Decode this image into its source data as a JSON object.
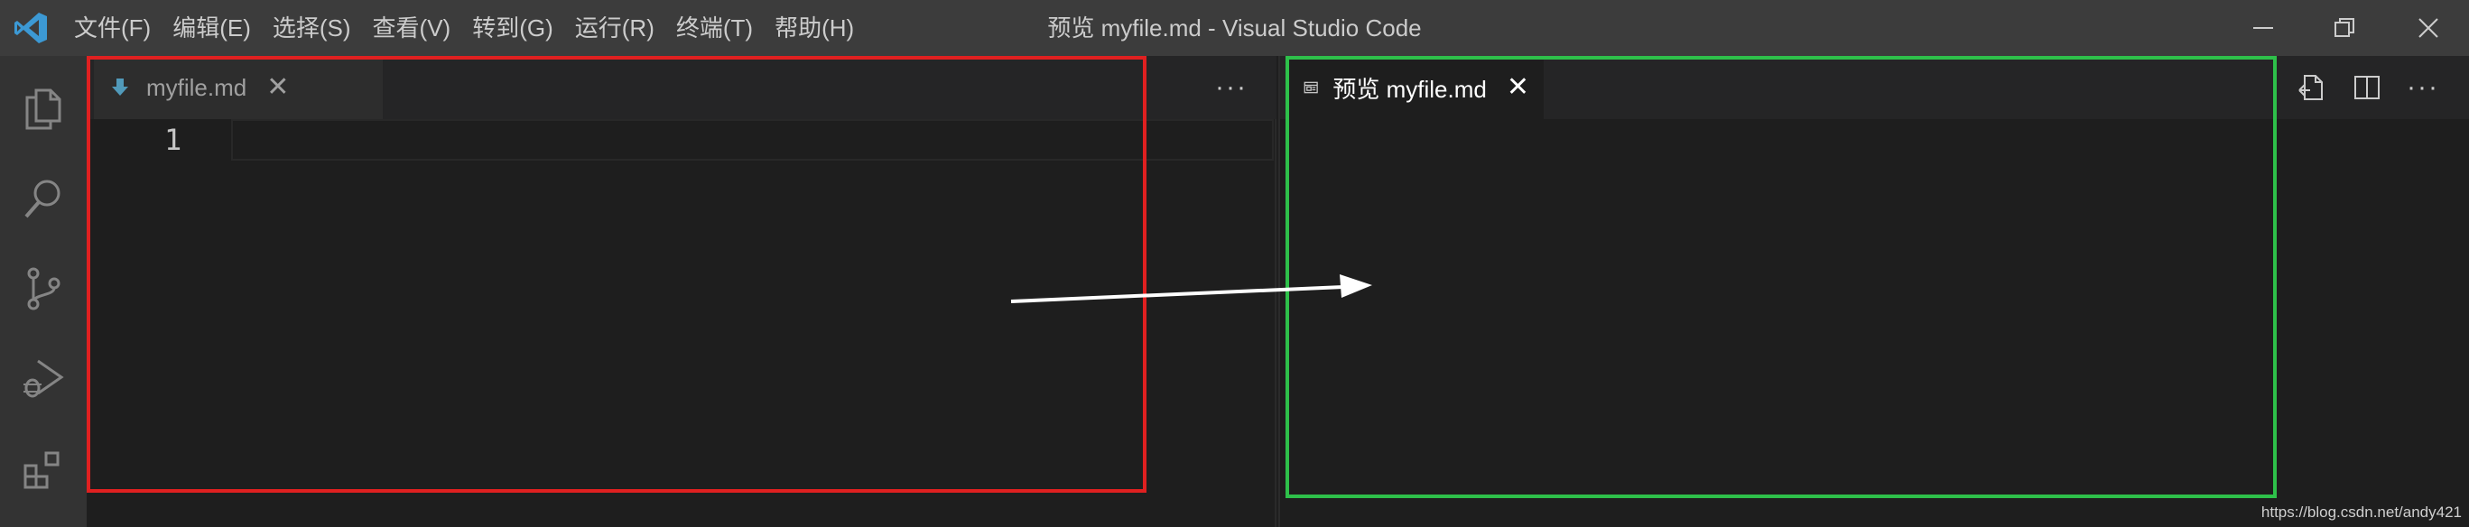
{
  "window": {
    "title": "预览 myfile.md - Visual Studio Code"
  },
  "menubar": {
    "items": [
      "文件(F)",
      "编辑(E)",
      "选择(S)",
      "查看(V)",
      "转到(G)",
      "运行(R)",
      "终端(T)",
      "帮助(H)"
    ]
  },
  "activity_icons": [
    "files-icon",
    "search-icon",
    "source-control-icon",
    "run-debug-icon",
    "extensions-icon"
  ],
  "editor": {
    "tab_label": "myfile.md",
    "tab_close": "✕",
    "line_number": "1",
    "more_label": "···"
  },
  "preview": {
    "tab_label": "预览 myfile.md",
    "tab_close": "✕",
    "more_label": "···"
  },
  "colors": {
    "annotation_editor": "#e02020",
    "annotation_preview": "#2ec04a",
    "vscode_blue": "#3c99d4",
    "markdown_icon": "#519aba"
  },
  "watermark": "https://blog.csdn.net/andy421"
}
